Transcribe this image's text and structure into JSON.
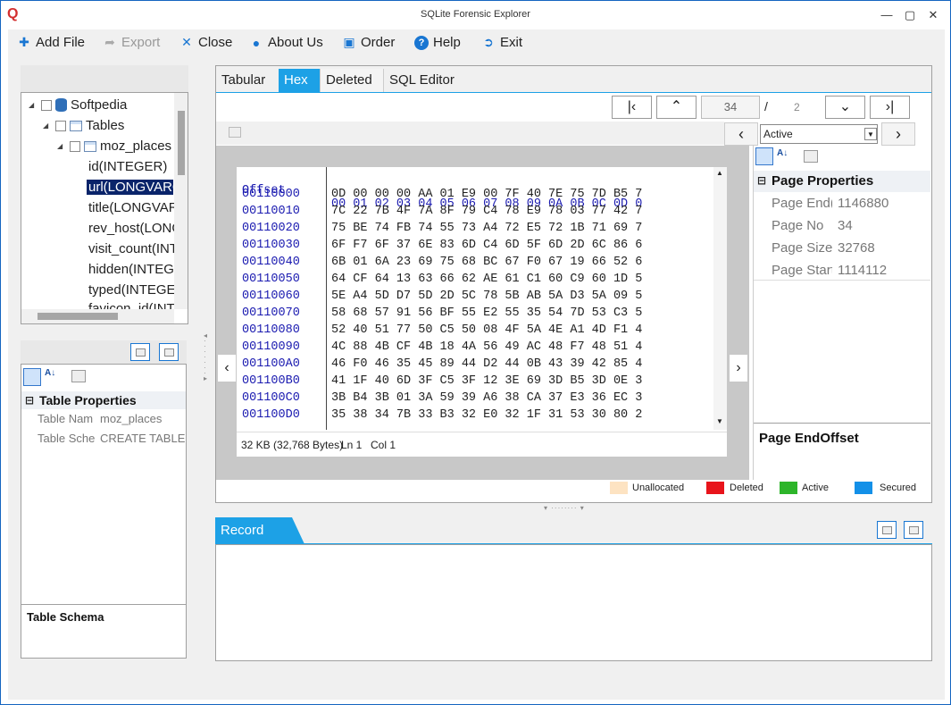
{
  "app": {
    "title": "SQLite Forensic Explorer"
  },
  "toolbar": {
    "add_file": "Add File",
    "export": "Export",
    "close": "Close",
    "about": "About Us",
    "order": "Order",
    "help": "Help",
    "exit": "Exit"
  },
  "tree": {
    "root": "Softpedia",
    "tables": "Tables",
    "table": "moz_places",
    "columns": [
      "id(INTEGER)",
      "url(LONGVARC",
      "title(LONGVAR",
      "rev_host(LONG",
      "visit_count(INT",
      "hidden(INTEGE",
      "typed(INTEGER",
      "favicon_id(INT"
    ]
  },
  "table_props": {
    "header": "Table Properties",
    "name_label": "Table Nam",
    "name_value": "moz_places",
    "schema_label": "Table Sche",
    "schema_value": "CREATE TABLE m",
    "footer": "Table Schema"
  },
  "tabs": [
    "Tabular",
    "Hex",
    "Deleted",
    "SQL Editor"
  ],
  "nav": {
    "page_current": "34",
    "page_sep": "/",
    "page_total": "2",
    "filter_value": "Active"
  },
  "hex": {
    "offset_header": "Offset",
    "col_header": "00 01 02 03 04 05 06 07 08 09 0A 0B 0C 0D 0",
    "rows": [
      {
        "offset": "00110000",
        "bytes": "0D 00 00 00 AA 01 E9 00 7F 40 7E 75 7D B5 7"
      },
      {
        "offset": "00110010",
        "bytes": "7C 22 7B 4F 7A 8F 79 C4 78 E9 78 03 77 42 7"
      },
      {
        "offset": "00110020",
        "bytes": "75 BE 74 FB 74 55 73 A4 72 E5 72 1B 71 69 7"
      },
      {
        "offset": "00110030",
        "bytes": "6F F7 6F 37 6E 83 6D C4 6D 5F 6D 2D 6C 86 6"
      },
      {
        "offset": "00110040",
        "bytes": "6B 01 6A 23 69 75 68 BC 67 F0 67 19 66 52 6"
      },
      {
        "offset": "00110050",
        "bytes": "64 CF 64 13 63 66 62 AE 61 C1 60 C9 60 1D 5"
      },
      {
        "offset": "00110060",
        "bytes": "5E A4 5D D7 5D 2D 5C 78 5B AB 5A D3 5A 09 5"
      },
      {
        "offset": "00110070",
        "bytes": "58 68 57 91 56 BF 55 E2 55 35 54 7D 53 C3 5"
      },
      {
        "offset": "00110080",
        "bytes": "52 40 51 77 50 C5 50 08 4F 5A 4E A1 4D F1 4"
      },
      {
        "offset": "00110090",
        "bytes": "4C 88 4B CF 4B 18 4A 56 49 AC 48 F7 48 51 4"
      },
      {
        "offset": "001100A0",
        "bytes": "46 F0 46 35 45 89 44 D2 44 0B 43 39 42 85 4"
      },
      {
        "offset": "001100B0",
        "bytes": "41 1F 40 6D 3F C5 3F 12 3E 69 3D B5 3D 0E 3"
      },
      {
        "offset": "001100C0",
        "bytes": "3B B4 3B 01 3A 59 39 A6 38 CA 37 E3 36 EC 3"
      },
      {
        "offset": "001100D0",
        "bytes": "35 38 34 7B 33 B3 32 E0 32 1F 31 53 30 80 2"
      }
    ],
    "status_size": "32 KB (32,768 Bytes)",
    "status_ln": "Ln 1",
    "status_col": "Col 1"
  },
  "page_props": {
    "header": "Page Properties",
    "rows": [
      {
        "label": "Page End(",
        "value": "1146880"
      },
      {
        "label": "Page No",
        "value": "34"
      },
      {
        "label": "Page Size",
        "value": "32768"
      },
      {
        "label": "Page Start",
        "value": "1114112"
      }
    ],
    "footer": "Page EndOffset"
  },
  "legend": [
    {
      "label": "Unallocated",
      "color": "#fde3c2"
    },
    {
      "label": "Deleted",
      "color": "#e8141b"
    },
    {
      "label": "Active",
      "color": "#2db52a"
    },
    {
      "label": "Secured",
      "color": "#1390e8"
    }
  ],
  "record": {
    "title": "Record"
  }
}
